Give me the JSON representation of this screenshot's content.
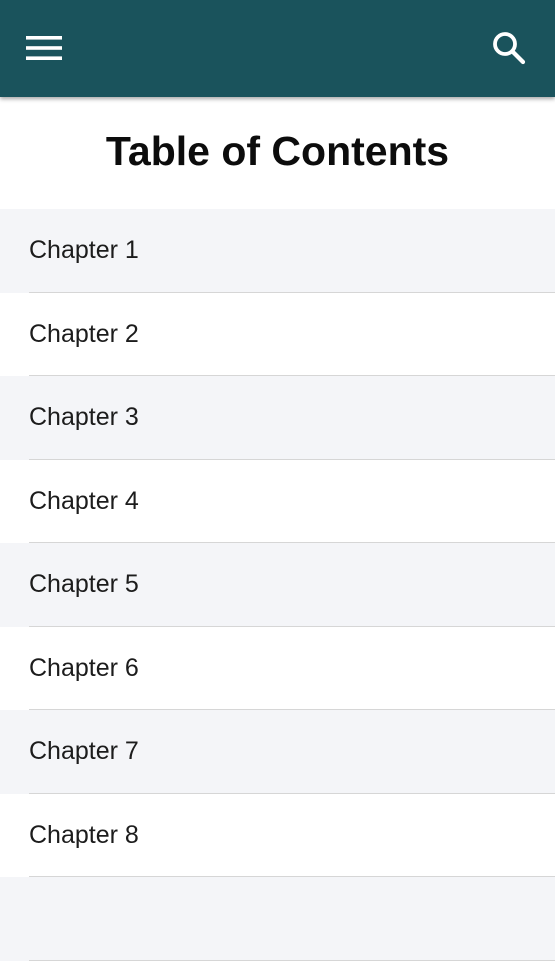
{
  "app_bar": {
    "background_color": "#1a535c",
    "menu_icon": "hamburger-menu-icon",
    "search_icon": "search-icon"
  },
  "page": {
    "title": "Table of Contents"
  },
  "chapters": [
    {
      "label": "Chapter 1"
    },
    {
      "label": "Chapter 2"
    },
    {
      "label": "Chapter 3"
    },
    {
      "label": "Chapter 4"
    },
    {
      "label": "Chapter 5"
    },
    {
      "label": "Chapter 6"
    },
    {
      "label": "Chapter 7"
    },
    {
      "label": "Chapter 8"
    },
    {
      "label": ""
    }
  ]
}
